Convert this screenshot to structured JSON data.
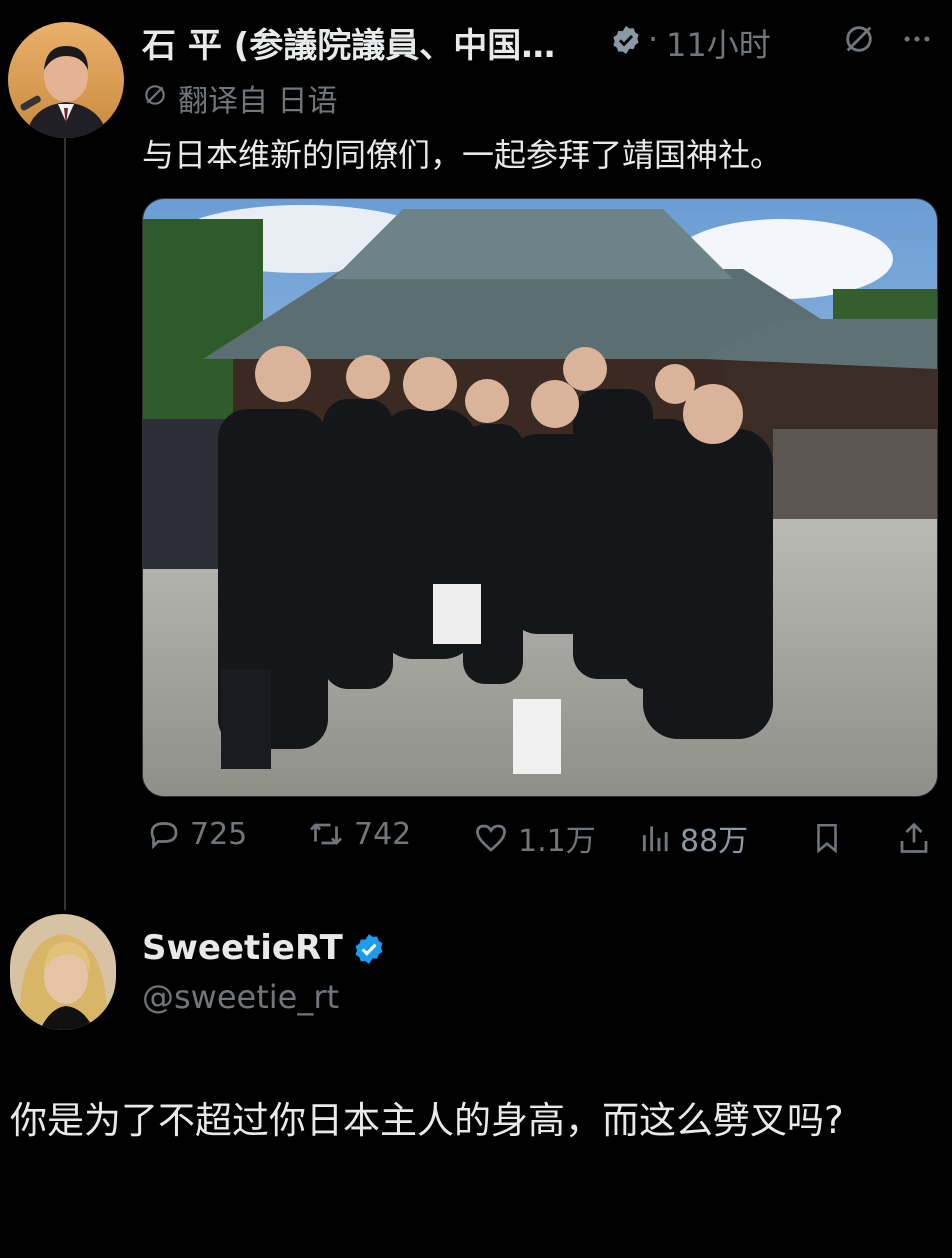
{
  "tweet": {
    "author_name": "石 平 (参議院議員、中国…",
    "timestamp": "11小时",
    "translated_label": "翻译自 日语",
    "text": "与日本维新的同僚们，一起参拜了靖国神社。",
    "photo_icon": "group-photo-shrine",
    "actions": {
      "reply_count": "725",
      "retweet_count": "742",
      "like_count": "1.1万",
      "view_count": "88万"
    }
  },
  "reply": {
    "author_name": "SweetieRT",
    "handle": "@sweetie_rt",
    "text": "你是为了不超过你日本主人的身高，而这么劈叉吗?"
  },
  "colors": {
    "background": "#000000",
    "text": "#e7e9ea",
    "muted": "#71767b",
    "verified": "#1d9bf0"
  }
}
